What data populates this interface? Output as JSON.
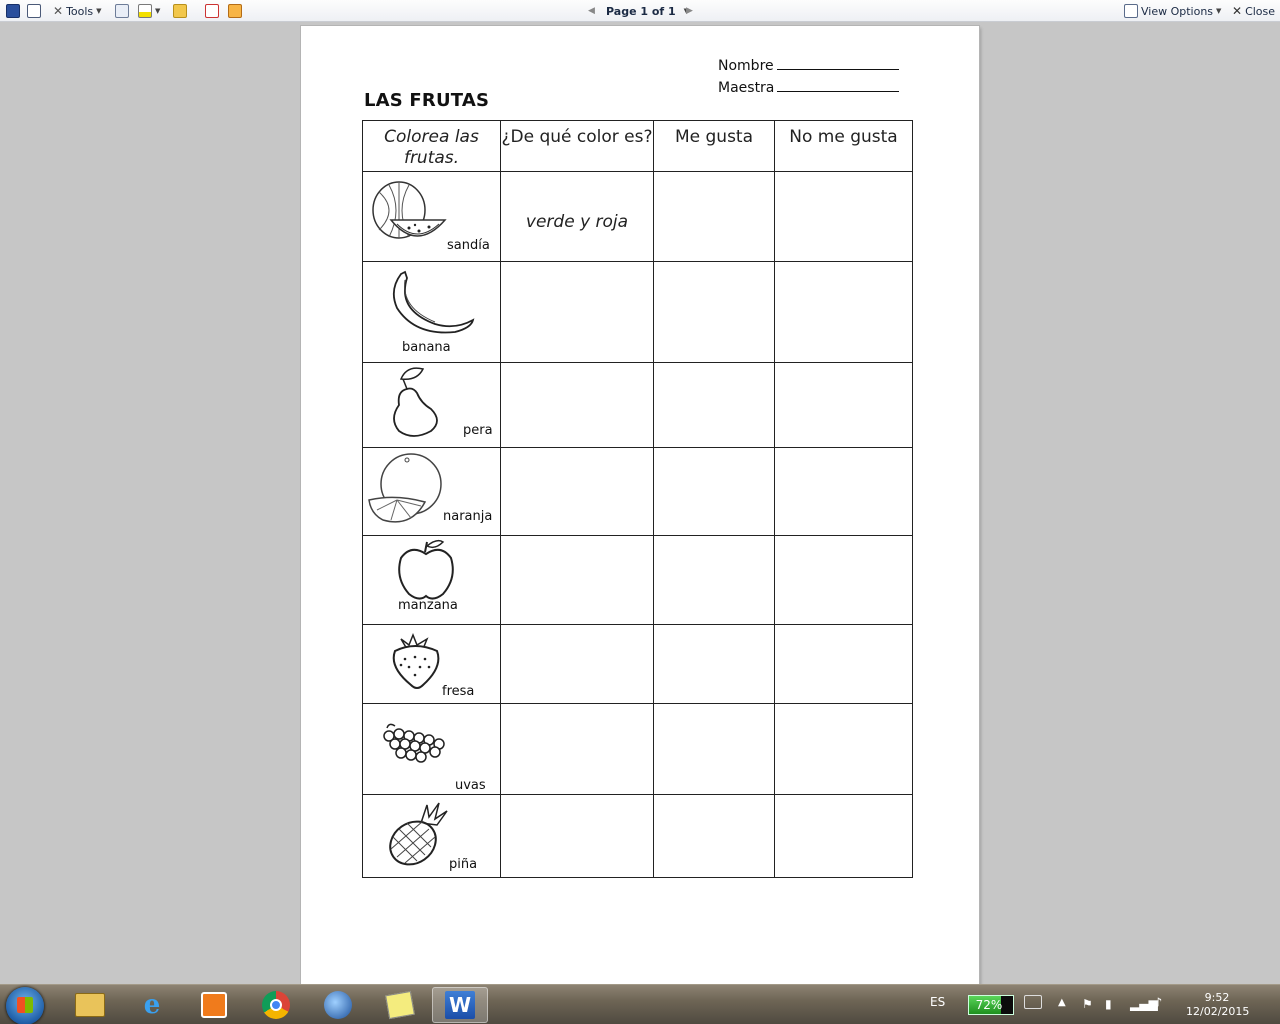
{
  "toolbar": {
    "tools_label": "Tools",
    "page_indicator": "Page 1 of 1",
    "view_options_label": "View Options",
    "close_label": "Close"
  },
  "document": {
    "name_label": "Nombre",
    "teacher_label": "Maestra",
    "title": "LAS FRUTAS",
    "table": {
      "headers": [
        "Colorea las frutas.",
        "¿De qué color es?",
        "Me gusta",
        "No me gusta"
      ],
      "rows": [
        {
          "fruit": "sandía",
          "color_answer": "verde y roja",
          "icon": "watermelon-icon"
        },
        {
          "fruit": "banana",
          "color_answer": "",
          "icon": "banana-icon"
        },
        {
          "fruit": "pera",
          "color_answer": "",
          "icon": "pear-icon"
        },
        {
          "fruit": "naranja",
          "color_answer": "",
          "icon": "orange-icon"
        },
        {
          "fruit": "manzana",
          "color_answer": "",
          "icon": "apple-icon"
        },
        {
          "fruit": "fresa",
          "color_answer": "",
          "icon": "strawberry-icon"
        },
        {
          "fruit": "uvas",
          "color_answer": "",
          "icon": "grapes-icon"
        },
        {
          "fruit": "piña",
          "color_answer": "",
          "icon": "pineapple-icon"
        }
      ]
    }
  },
  "taskbar": {
    "language": "ES",
    "battery_percent": "72%",
    "battery_level": 0.72,
    "time": "9:52",
    "date": "12/02/2015"
  }
}
